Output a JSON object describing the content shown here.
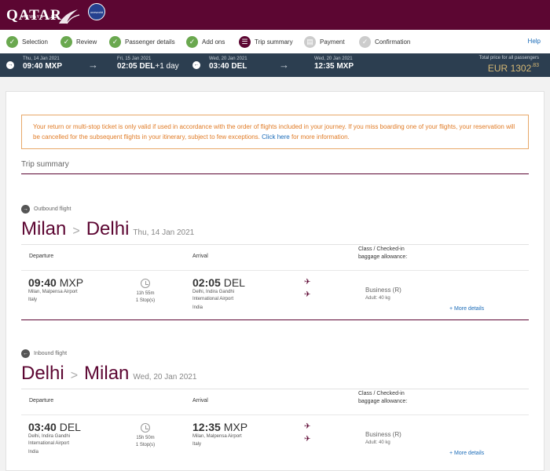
{
  "brand": {
    "name": "QATAR",
    "sub": "AIRWAYS القطرية",
    "alliance": "oneworld"
  },
  "steps": [
    {
      "label": "Selection",
      "state": "done"
    },
    {
      "label": "Review",
      "state": "done"
    },
    {
      "label": "Passenger details",
      "state": "done"
    },
    {
      "label": "Add ons",
      "state": "done"
    },
    {
      "label": "Trip summary",
      "state": "current"
    },
    {
      "label": "Payment",
      "state": "todo"
    },
    {
      "label": "Confirmation",
      "state": "todo"
    }
  ],
  "help": "Help",
  "strip": {
    "seg1": {
      "date": "Thu, 14 Jan 2021",
      "time": "09:40 MXP"
    },
    "seg2": {
      "date": "Fri, 15 Jan 2021",
      "time": "02:05 DEL",
      "extra": "+1 day"
    },
    "seg3": {
      "date": "Wed, 20 Jan 2021",
      "time": "03:40 DEL"
    },
    "seg4": {
      "date": "Wed, 20 Jan 2021",
      "time": "12:35 MXP"
    },
    "price_label": "Total price for all passengers",
    "currency": "EUR",
    "amount": "1302",
    "cents": ".83"
  },
  "notice": {
    "text": "Your return or multi-stop ticket is only valid if used in accordance with the order of flights included in your journey. If you miss boarding one of your flights, your reservation will be cancelled for the subsequent flights in your itinerary, subject to few exceptions.",
    "link": "Click here",
    "tail": "for more information."
  },
  "trip_summary": "Trip summary",
  "outbound": {
    "title": "Outbound flight",
    "from": "Milan",
    "to": "Delhi",
    "date": "Thu, 14 Jan 2021",
    "col_dep": "Departure",
    "col_arr": "Arrival",
    "col_class": "Class / Checked-in baggage allowance:",
    "dep_time": "09:40",
    "dep_code": "MXP",
    "dep_airport": "Milan, Malpensa Airport",
    "dep_country": "Italy",
    "duration": "11h 55m",
    "stops": "1 Stop(s)",
    "arr_time": "02:05",
    "arr_code": "DEL",
    "arr_airport": "Delhi, Indira Gandhi International Airport",
    "arr_country": "India",
    "class": "Business (R)",
    "baggage": "Adult: 40 kg",
    "more": "+ More details"
  },
  "inbound": {
    "title": "Inbound flight",
    "from": "Delhi",
    "to": "Milan",
    "date": "Wed, 20 Jan 2021",
    "col_dep": "Departure",
    "col_arr": "Arrival",
    "col_class": "Class / Checked-in baggage allowance:",
    "dep_time": "03:40",
    "dep_code": "DEL",
    "dep_airport": "Delhi, Indira Gandhi International Airport",
    "dep_country": "India",
    "duration": "15h 50m",
    "stops": "1 Stop(s)",
    "arr_time": "12:35",
    "arr_code": "MXP",
    "arr_airport": "Milan, Malpensa Airport",
    "arr_country": "Italy",
    "class": "Business (R)",
    "baggage": "Adult: 40 kg",
    "more": "+ More details"
  }
}
